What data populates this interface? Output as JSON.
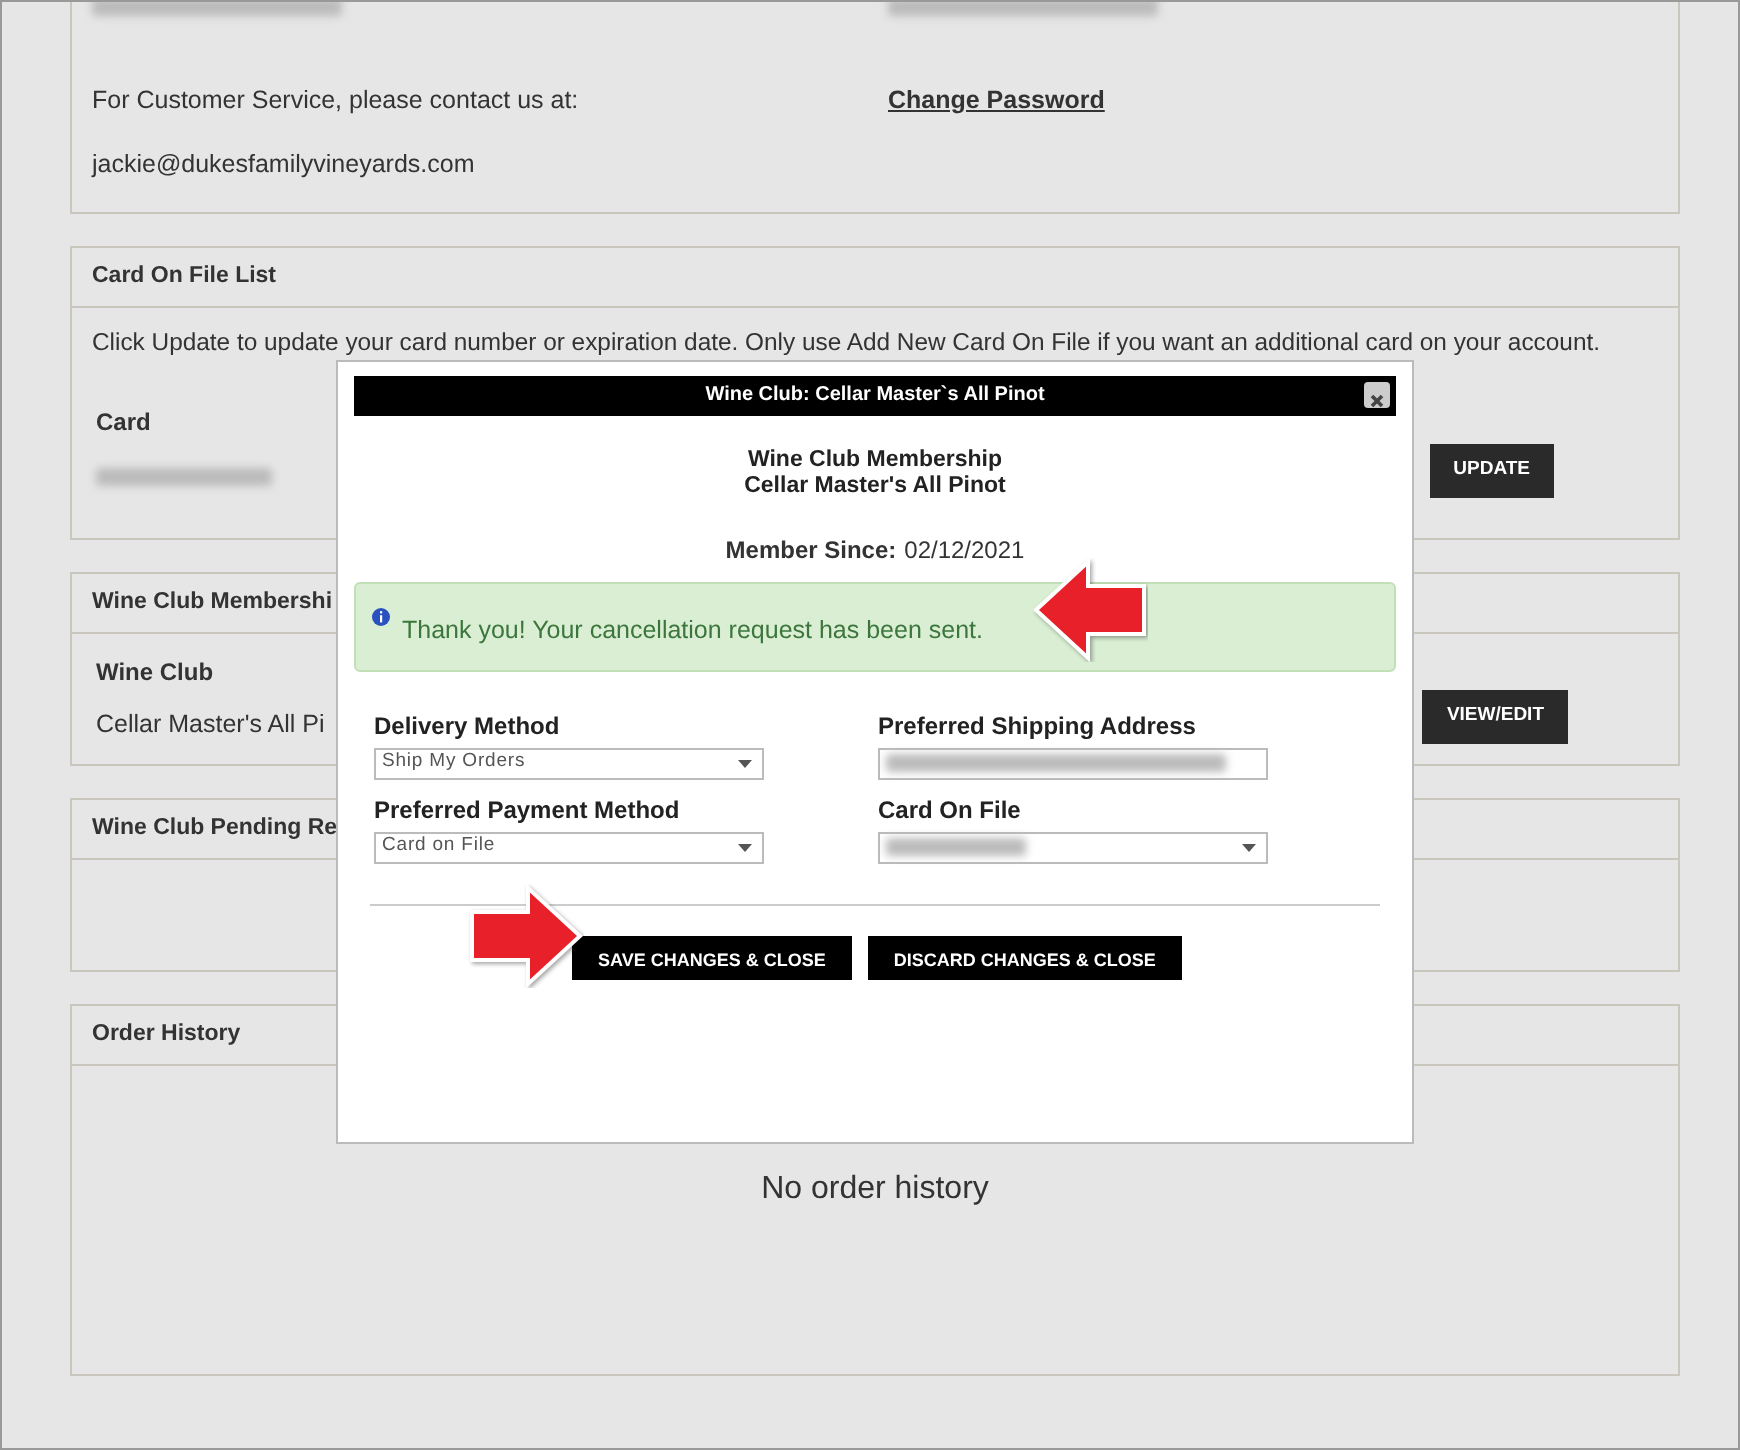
{
  "account_panel": {
    "customer_service_label": "For Customer Service, please contact us at:",
    "email": "jackie@dukesfamilyvineyards.com",
    "change_password_link": "Change Password"
  },
  "card_panel": {
    "title": "Card On File List",
    "description": "Click Update to update your card number or expiration date. Only use Add New Card On File if you want an additional card on your account.",
    "card_label": "Card",
    "update_button": "UPDATE"
  },
  "membership_panel": {
    "title": "Wine Club Membershi",
    "wine_club_label": "Wine Club",
    "club_name": "Cellar Master's All Pi",
    "view_edit_button": "VIEW/EDIT"
  },
  "pending_panel": {
    "title": "Wine Club Pending Re"
  },
  "order_history_panel": {
    "title": "Order History",
    "empty_message": "No order history"
  },
  "modal": {
    "title": "Wine Club: Cellar Master`s All Pinot",
    "heading_lines": [
      "Wine Club Membership",
      "Cellar Master's All Pinot"
    ],
    "member_since_label": "Member Since:",
    "member_since": "02/12/2021",
    "alert": "Thank you! Your cancellation request has been sent.",
    "fields": [
      {
        "label": "Delivery Method",
        "kind": "select",
        "value": "Ship My Orders",
        "redacted": false
      },
      {
        "label": "Preferred Shipping Address",
        "kind": "input",
        "redacted": true
      },
      {
        "label": "Preferred Payment Method",
        "kind": "select",
        "value": "Card on File",
        "redacted": false
      },
      {
        "label": "Card On File",
        "kind": "select",
        "redacted": true
      }
    ],
    "buttons": [
      "SAVE CHANGES & CLOSE",
      "DISCARD CHANGES & CLOSE"
    ]
  }
}
